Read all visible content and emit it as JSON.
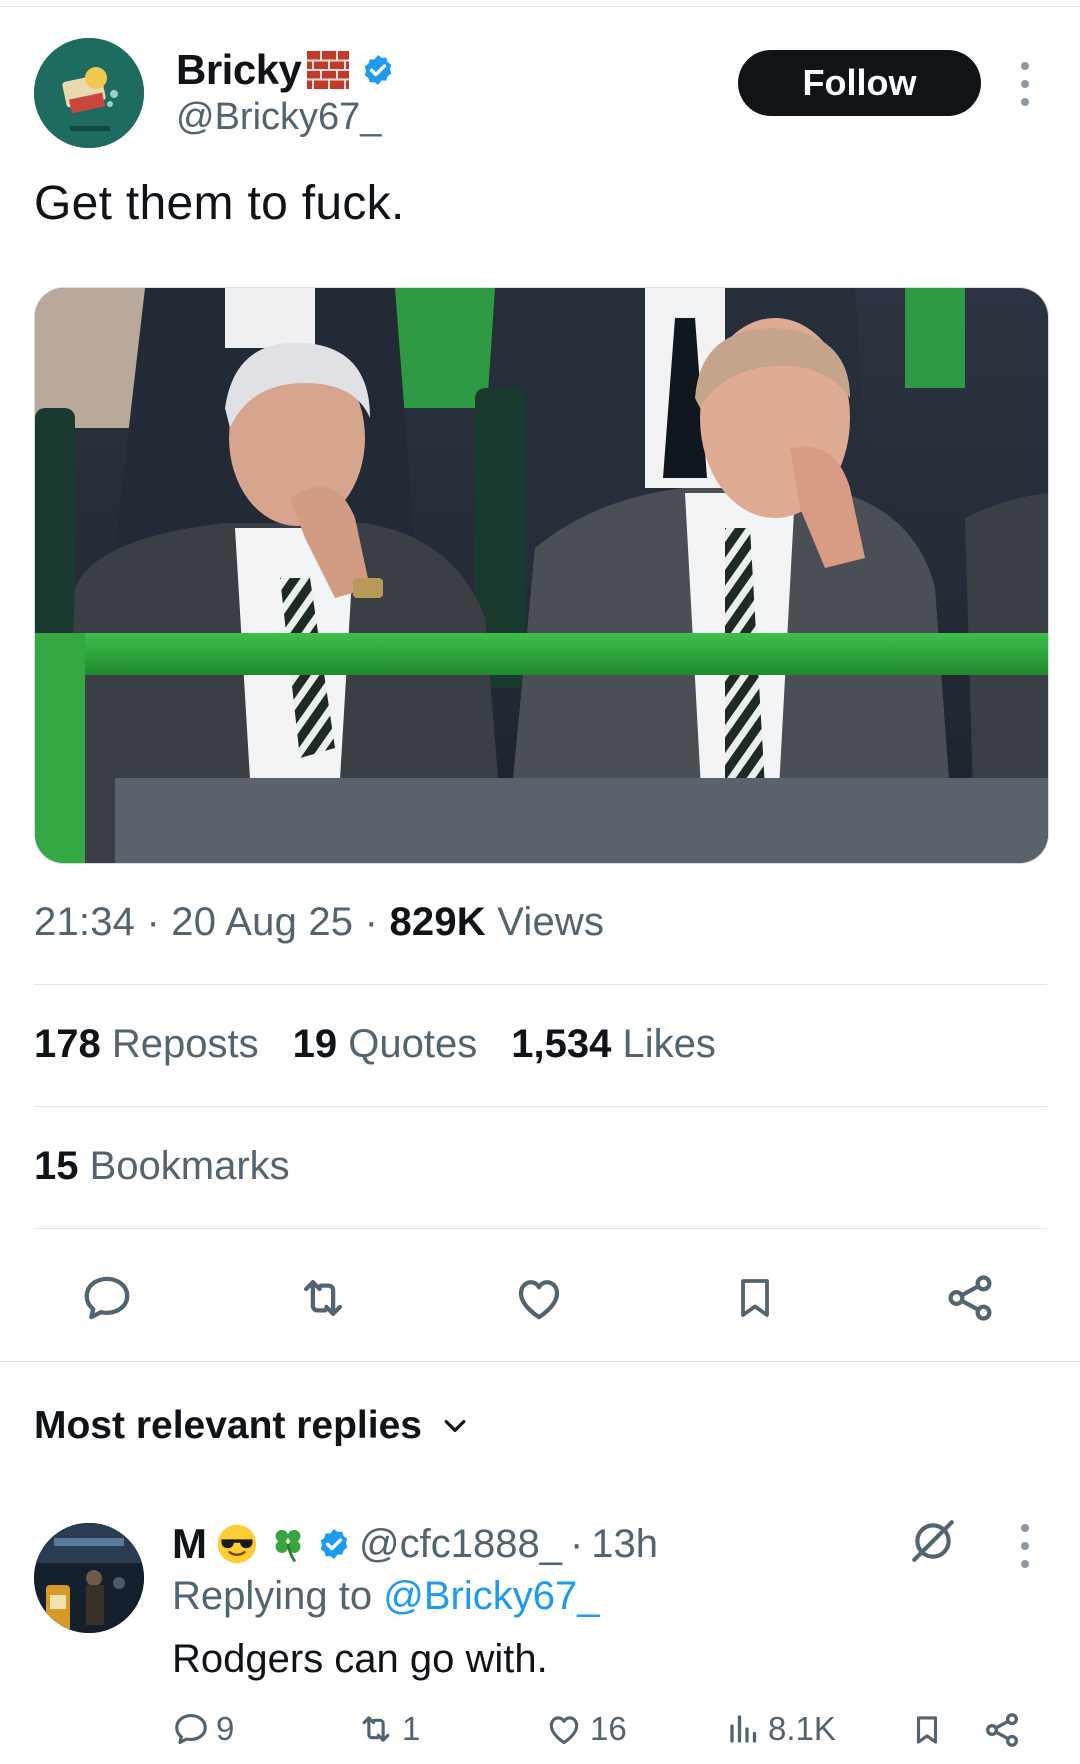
{
  "tweet": {
    "author": {
      "display_name": "Bricky",
      "name_emoji": "🧱",
      "handle": "@Bricky67_",
      "verified": true
    },
    "follow_label": "Follow",
    "text": "Get them to fuck.",
    "time": "21:34",
    "date": "20 Aug 25",
    "views_count": "829K",
    "views_label": "Views",
    "stats": {
      "reposts_count": "178",
      "reposts_label": "Reposts",
      "quotes_count": "19",
      "quotes_label": "Quotes",
      "likes_count": "1,534",
      "likes_label": "Likes",
      "bookmarks_count": "15",
      "bookmarks_label": "Bookmarks"
    },
    "actions": [
      "reply-icon",
      "repost-icon",
      "like-icon",
      "bookmark-icon",
      "share-icon"
    ]
  },
  "replies": {
    "sort_label": "Most relevant replies",
    "items": [
      {
        "name": "M",
        "emojis": "😎🍀",
        "verified": true,
        "handle": "@cfc1888_",
        "time": "13h",
        "replying_prefix": "Replying to",
        "replying_to": "@Bricky67_",
        "text": "Rodgers can go with.",
        "reply_count": "9",
        "repost_count": "1",
        "like_count": "16",
        "views_count": "8.1K"
      }
    ]
  },
  "colors": {
    "accent": "#1d9bf0",
    "text": "#0f1419",
    "secondary": "#536471",
    "follow_bg": "#0f1419"
  }
}
